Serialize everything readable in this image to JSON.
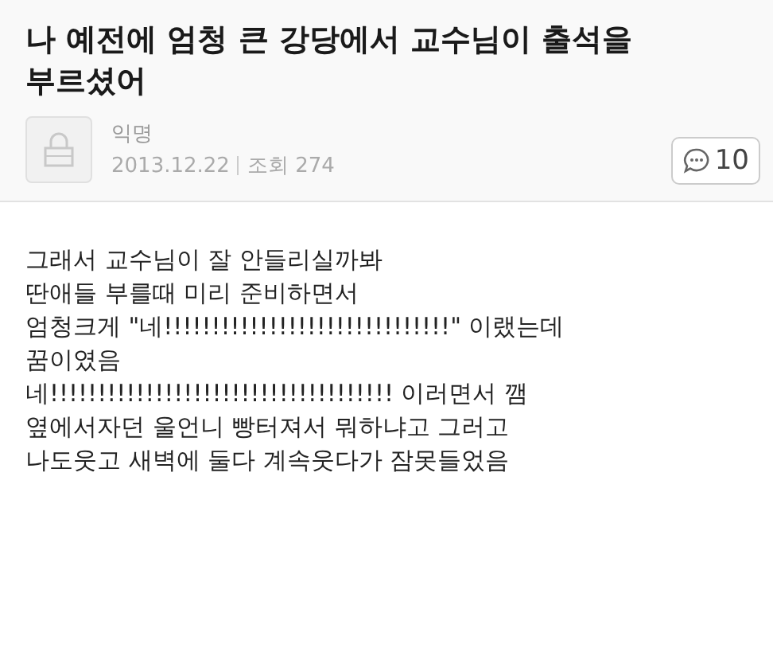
{
  "post": {
    "title": "나 예전에 엄청 큰 강당에서 교수님이 출석을 부르셨어",
    "author": "익명",
    "date": "2013.12.22",
    "views": "조회 274",
    "comment_count": "10",
    "body": [
      "그래서 교수님이 잘 안들리실까봐",
      "딴애들 부를때 미리 준비하면서",
      "엄청크게 \"네!!!!!!!!!!!!!!!!!!!!!!!!!!!!!!\" 이랬는데",
      "꿈이였음",
      "네!!!!!!!!!!!!!!!!!!!!!!!!!!!!!!!!!!!! 이러면서 깸",
      "옆에서자던 울언니 빵터져서 뭐하냐고 그러고",
      "나도웃고 새벽에 둘다 계속웃다가 잠못들었음"
    ]
  }
}
